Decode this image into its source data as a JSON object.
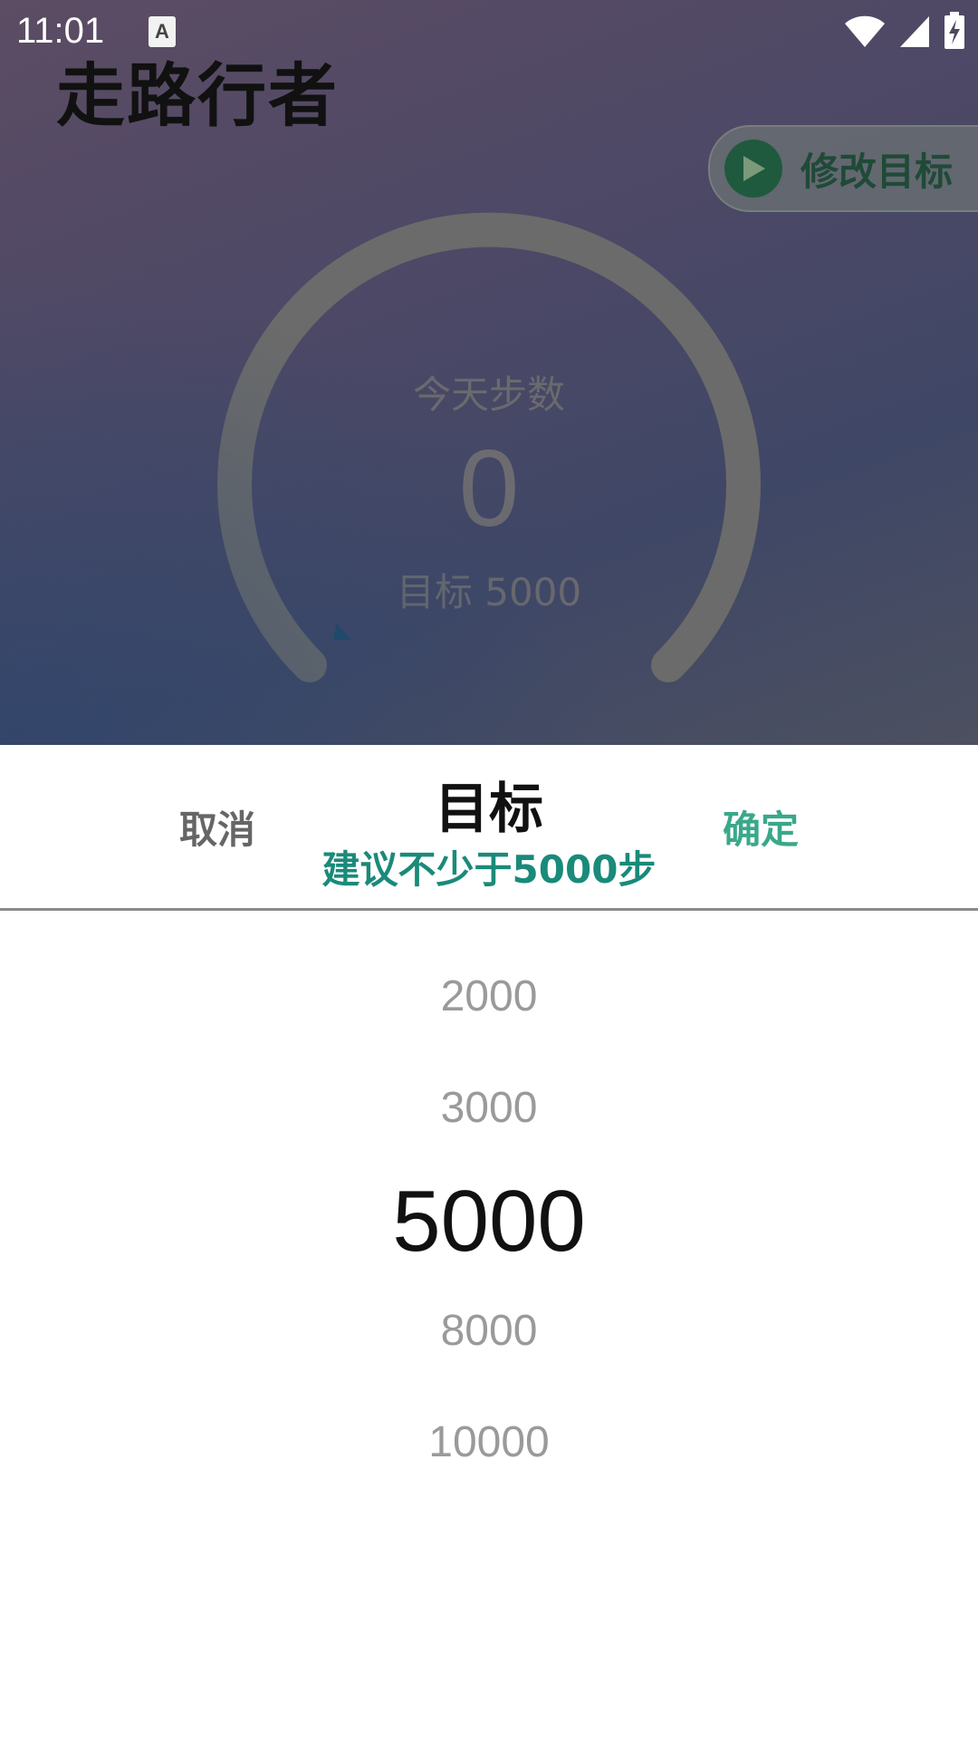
{
  "status_bar": {
    "time": "11:01",
    "notification_icon": "A"
  },
  "app": {
    "title": "走路行者",
    "edit_goal_label": "修改目标",
    "gauge": {
      "label": "今天步数",
      "steps": "0",
      "target": "目标 5000",
      "progress_fraction": 0
    }
  },
  "sheet": {
    "cancel_label": "取消",
    "title": "目标",
    "subtitle": "建议不少于5000步",
    "confirm_label": "确定",
    "options": [
      "2000",
      "3000",
      "5000",
      "8000",
      "10000"
    ],
    "selected": "5000"
  },
  "colors": {
    "accent": "#3aa88a",
    "subtitle": "#1a8a7a",
    "gauge_track": "#6b6b6b"
  }
}
